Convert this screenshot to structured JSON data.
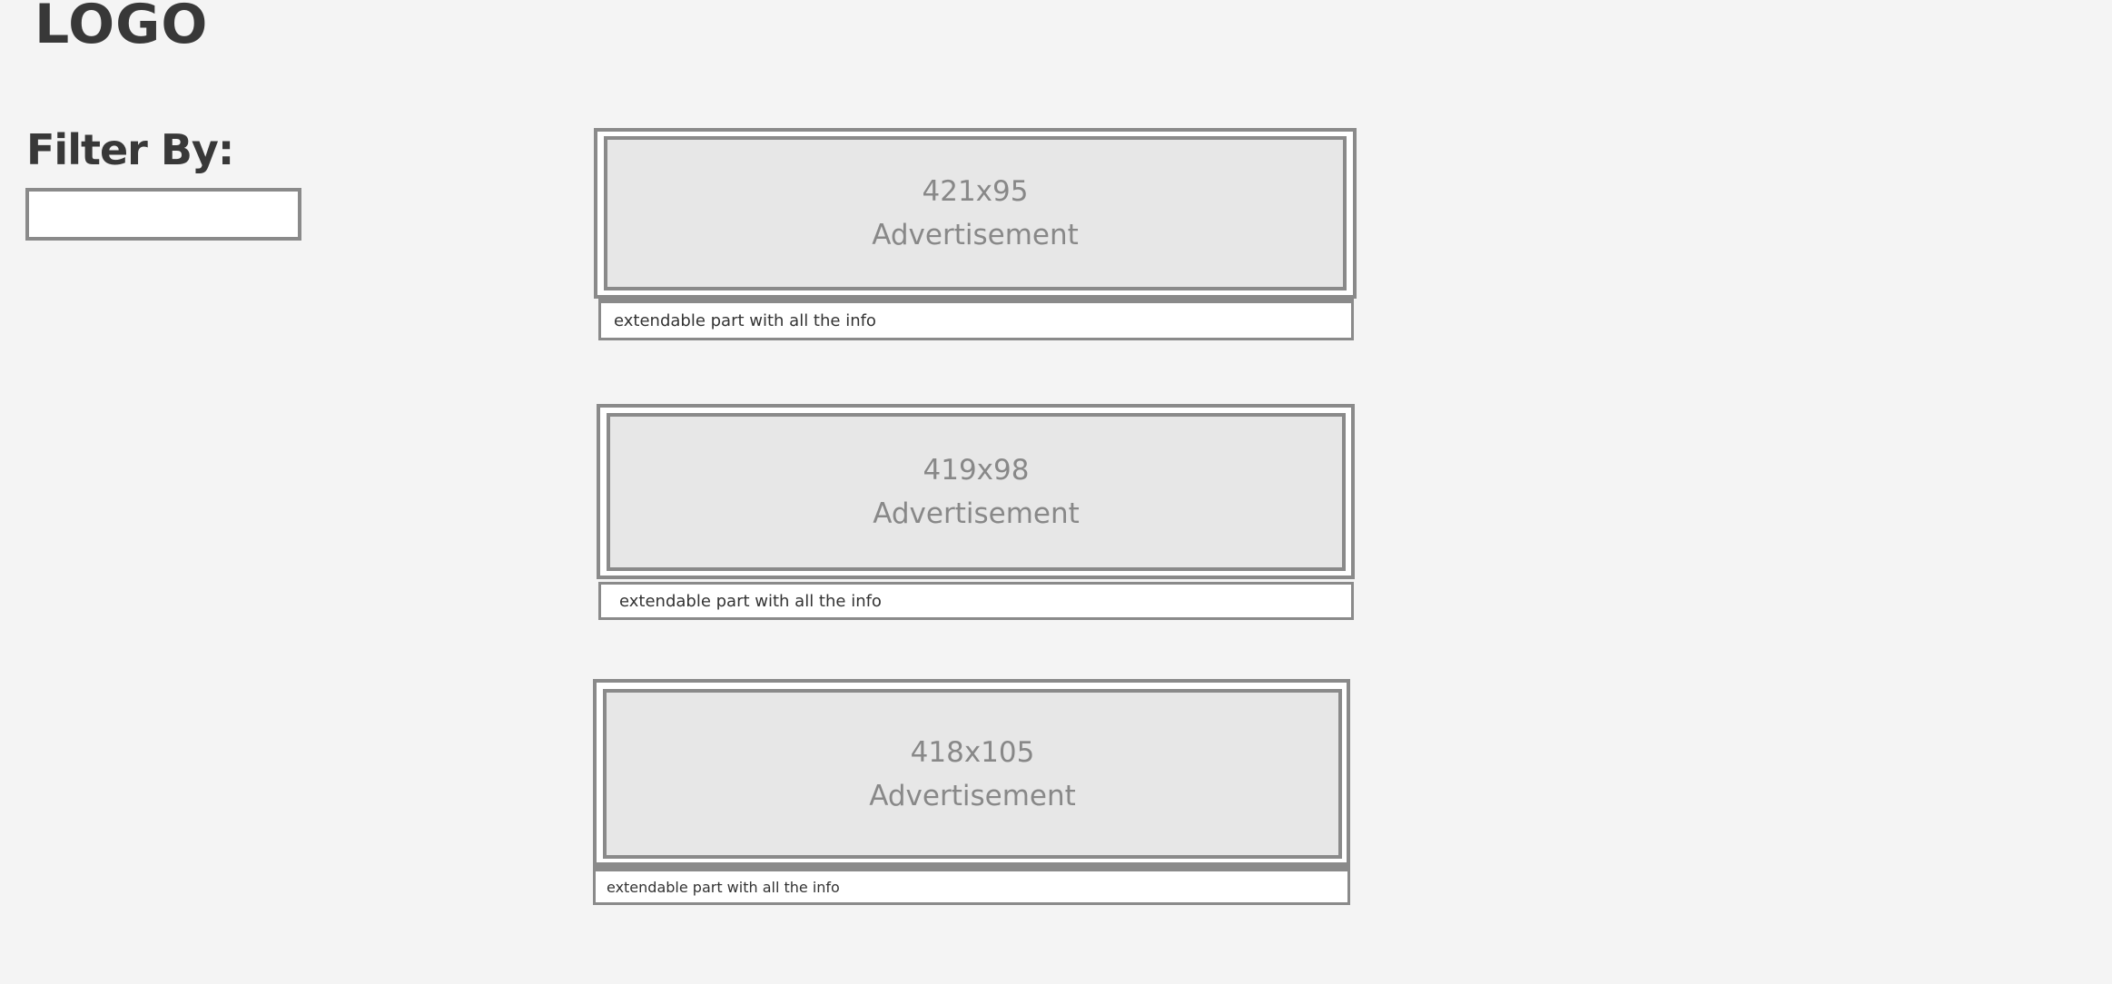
{
  "header": {
    "logo": "LOGO"
  },
  "sidebar": {
    "filter_label": "Filter By:",
    "filter_value": ""
  },
  "ads": [
    {
      "size": "421x95",
      "label": "Advertisement",
      "info": "extendable part  with all the info"
    },
    {
      "size": "419x98",
      "label": "Advertisement",
      "info": "extendable part  with all the info"
    },
    {
      "size": "418x105",
      "label": "Advertisement",
      "info": "extendable part  with all the info"
    }
  ]
}
